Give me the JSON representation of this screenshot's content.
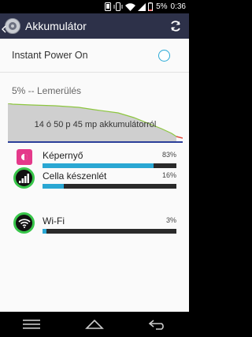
{
  "status_bar": {
    "battery_percent_text": "5%",
    "time": "0:36",
    "icons": [
      "phone-icon",
      "vibrate-icon",
      "wifi-icon",
      "signal-icon",
      "battery-icon"
    ]
  },
  "action_bar": {
    "title": "Akkumulátor",
    "icons": [
      "back-arrow-icon",
      "app-icon",
      "refresh-icon"
    ]
  },
  "instant_power": {
    "label": "Instant Power On",
    "checked": false
  },
  "status_line": "5% -- Lemerülés",
  "graph": {
    "label": "14 ó 50 p 45 mp akkumulátorról"
  },
  "usage": [
    {
      "name": "Képernyő",
      "percent_text": "83%",
      "fraction": 0.83,
      "icon": "screen-icon"
    },
    {
      "name": "Cella készenlét",
      "percent_text": "16%",
      "fraction": 0.16,
      "icon": "cell-signal-icon"
    },
    {
      "name": "Wi-Fi",
      "percent_text": "3%",
      "fraction": 0.03,
      "icon": "wifi-icon"
    }
  ],
  "nav": [
    "menu-icon",
    "home-icon",
    "back-icon"
  ],
  "colors": {
    "action_bar": "#2d3149",
    "accent": "#29a9d6",
    "bar_fill": "#2aa7d3",
    "screen_icon": "#e4398a",
    "ring_green": "#38c64a"
  }
}
